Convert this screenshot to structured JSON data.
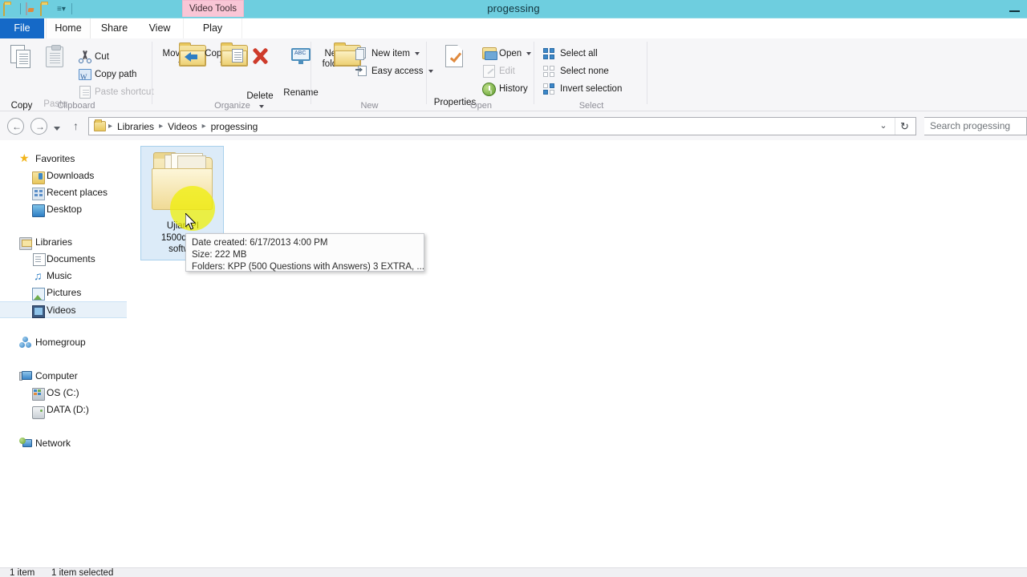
{
  "window": {
    "title": "progessing",
    "contextual_tab": "Video Tools",
    "minimize_label": "Minimize",
    "quick_access": [
      {
        "name": "folder-icon",
        "label": "Properties"
      },
      {
        "name": "new-folder-icon",
        "label": "New folder"
      },
      {
        "name": "customize-qat-icon",
        "label": "Customize Quick Access Toolbar"
      }
    ],
    "titlebar_color": "#6ECEDF",
    "contextual_tab_color": "#F9C6D6"
  },
  "tabs": [
    {
      "label": "File",
      "active": false,
      "accent": "#1569C7"
    },
    {
      "label": "Home",
      "active": true
    },
    {
      "label": "Share",
      "active": false
    },
    {
      "label": "View",
      "active": false
    },
    {
      "label": "Play",
      "active": false
    }
  ],
  "ribbon": {
    "groups": [
      {
        "label": "Clipboard",
        "big": [
          {
            "label": "Copy",
            "icon": "copy-icon",
            "disabled": false
          },
          {
            "label": "Paste",
            "icon": "paste-icon",
            "disabled": true
          }
        ],
        "small": [
          {
            "label": "Cut",
            "icon": "cut-icon",
            "disabled": false
          },
          {
            "label": "Copy path",
            "icon": "copy-path-icon",
            "disabled": false
          },
          {
            "label": "Paste shortcut",
            "icon": "paste-shortcut-icon",
            "disabled": true
          }
        ]
      },
      {
        "label": "Organize",
        "big": [
          {
            "label": "Move to",
            "icon": "move-to-icon",
            "has_caret": true
          },
          {
            "label": "Copy to",
            "icon": "copy-to-icon",
            "has_caret": true
          },
          {
            "label": "Delete",
            "icon": "delete-icon",
            "has_caret": true
          },
          {
            "label": "Rename",
            "icon": "rename-icon",
            "has_caret": false
          }
        ],
        "small": []
      },
      {
        "label": "New",
        "big": [
          {
            "label": "New folder",
            "icon": "new-folder-icon",
            "has_caret": false
          }
        ],
        "small": [
          {
            "label": "New item",
            "icon": "new-item-icon",
            "has_caret": true
          },
          {
            "label": "Easy access",
            "icon": "easy-access-icon",
            "has_caret": true
          }
        ]
      },
      {
        "label": "Open",
        "big": [
          {
            "label": "Properties",
            "icon": "properties-icon",
            "has_caret": true
          }
        ],
        "small": [
          {
            "label": "Open",
            "icon": "open-icon",
            "has_caret": true,
            "disabled": false
          },
          {
            "label": "Edit",
            "icon": "edit-icon",
            "disabled": true
          },
          {
            "label": "History",
            "icon": "history-icon",
            "disabled": false
          }
        ]
      },
      {
        "label": "Select",
        "big": [],
        "small": [
          {
            "label": "Select all",
            "icon": "select-all-icon",
            "disabled": false
          },
          {
            "label": "Select none",
            "icon": "select-none-icon",
            "disabled": false
          },
          {
            "label": "Invert selection",
            "icon": "invert-selection-icon",
            "disabled": false
          }
        ]
      }
    ]
  },
  "addressbar": {
    "back_glyph": "←",
    "forward_glyph": "→",
    "recent_dropdown": "Recent locations",
    "up_glyph": "↑",
    "breadcrumbs": [
      "Libraries",
      "Videos",
      "progessing"
    ],
    "separator": "▸",
    "history_dropdown_glyph": "⌄",
    "refresh_glyph": "↻",
    "search_placeholder": "Search progessing"
  },
  "navpane": {
    "sections": [
      {
        "items": [
          {
            "label": "Favorites",
            "icon": "favorites-star-icon",
            "indent": 24,
            "selected": false
          },
          {
            "label": "Downloads",
            "icon": "downloads-icon",
            "indent": 40,
            "selected": false
          },
          {
            "label": "Recent places",
            "icon": "recent-places-icon",
            "indent": 40,
            "selected": false
          },
          {
            "label": "Desktop",
            "icon": "desktop-icon",
            "indent": 40,
            "selected": false
          }
        ]
      },
      {
        "items": [
          {
            "label": "Libraries",
            "icon": "libraries-icon",
            "indent": 24,
            "selected": false
          },
          {
            "label": "Documents",
            "icon": "documents-icon",
            "indent": 40,
            "selected": false
          },
          {
            "label": "Music",
            "icon": "music-icon",
            "indent": 40,
            "selected": false
          },
          {
            "label": "Pictures",
            "icon": "pictures-icon",
            "indent": 40,
            "selected": false
          },
          {
            "label": "Videos",
            "icon": "videos-icon",
            "indent": 40,
            "selected": true
          }
        ]
      },
      {
        "items": [
          {
            "label": "Homegroup",
            "icon": "homegroup-icon",
            "indent": 24,
            "selected": false
          }
        ]
      },
      {
        "items": [
          {
            "label": "Computer",
            "icon": "computer-icon",
            "indent": 24,
            "selected": false
          },
          {
            "label": "OS (C:)",
            "icon": "os-drive-icon",
            "indent": 40,
            "selected": false
          },
          {
            "label": "DATA (D:)",
            "icon": "data-drive-icon",
            "indent": 40,
            "selected": false
          }
        ]
      },
      {
        "items": [
          {
            "label": "Network",
            "icon": "network-icon",
            "indent": 24,
            "selected": false
          }
        ]
      }
    ]
  },
  "filelist": {
    "items": [
      {
        "name": "folder-item",
        "label_lines": [
          "Ujian PI",
          "1500que...",
          "softw..."
        ],
        "selected": true,
        "icon": "folder-icon"
      }
    ]
  },
  "tooltip": {
    "lines": [
      "Date created: 6/17/2013 4:00 PM",
      "Size: 222 MB",
      "Folders: KPP (500 Questions with Answers) 3 EXTRA, ..."
    ]
  },
  "statusbar": {
    "item_count": "1 item",
    "selection": "1 item selected"
  }
}
